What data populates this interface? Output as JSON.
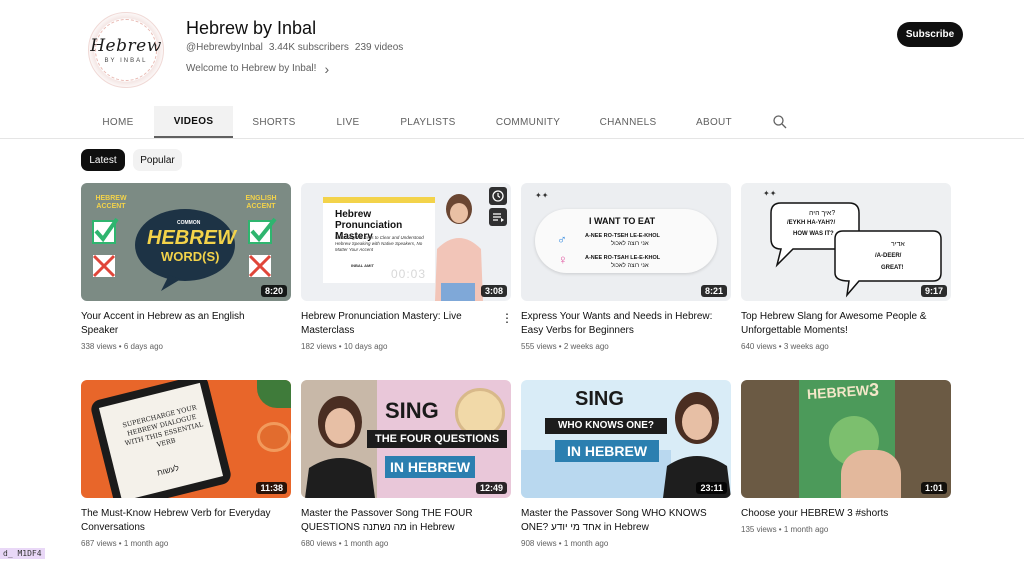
{
  "channel": {
    "logo_text": "Hebrew",
    "logo_sub": "BY INBAL",
    "name": "Hebrew by Inbal",
    "handle": "@HebrewbyInbal",
    "subscribers": "3.44K subscribers",
    "videos_count": "239 videos",
    "description": "Welcome to Hebrew by Inbal!",
    "subscribe_label": "Subscribe"
  },
  "tabs": [
    {
      "label": "HOME"
    },
    {
      "label": "VIDEOS"
    },
    {
      "label": "SHORTS"
    },
    {
      "label": "LIVE"
    },
    {
      "label": "PLAYLISTS"
    },
    {
      "label": "COMMUNITY"
    },
    {
      "label": "CHANNELS"
    },
    {
      "label": "ABOUT"
    }
  ],
  "active_tab": "VIDEOS",
  "filters": [
    {
      "label": "Latest"
    },
    {
      "label": "Popular"
    }
  ],
  "videos": [
    {
      "title": "Your Accent in Hebrew as an English Speaker",
      "meta": "338 views • 6 days ago",
      "duration": "8:20",
      "thumb": {
        "left_label": "HEBREW ACCENT",
        "right_label": "ENGLISH ACCENT",
        "center": "HEBREW",
        "center_small": "COMMON",
        "center_sub": "WORD(S)"
      }
    },
    {
      "title": "Hebrew Pronunciation Mastery: Live Masterclass",
      "meta": "182 views • 10 days ago",
      "duration": "3:08",
      "thumb": {
        "heading": "Hebrew Pronunciation Mastery",
        "sub": "Unlocking the Keys to Clear and Understood Hebrew Speaking with Native Speakers, No Matter Your Accent",
        "author": "INBAL AMIT",
        "timer": "00:03"
      }
    },
    {
      "title": "Express Your Wants and Needs in Hebrew: Easy Verbs for Beginners",
      "meta": "555 views • 2 weeks ago",
      "duration": "8:21",
      "thumb": {
        "heading": "I WANT TO EAT",
        "line1": "A-NEE  RO-TSEH  LE-E-KHOL",
        "line1_he": "אני רוצה לאכול",
        "line2": "A-NEE  RO-TSAH  LE-E-KHOL",
        "line2_he": "אני רוצה לאכול"
      }
    },
    {
      "title": "Top Hebrew Slang for Awesome People & Unforgettable Moments!",
      "meta": "640 views • 3 weeks ago",
      "duration": "9:17",
      "thumb": {
        "bubble1_he": "איך היה?",
        "bubble1": "/EYKH HA-YAH?/",
        "bubble1_en": "HOW WAS IT?",
        "bubble2_he": "אדיר",
        "bubble2": "/A-DEER/",
        "bubble2_en": "GREAT!"
      }
    },
    {
      "title": "The Must-Know Hebrew Verb for Everyday Conversations",
      "meta": "687 views • 1 month ago",
      "duration": "11:38",
      "thumb": {
        "text": "SUPERCHARGE YOUR HEBREW DIALOGUE WITH THIS ESSENTIAL VERB",
        "he": "לעשות"
      }
    },
    {
      "title": "Master the Passover Song THE FOUR QUESTIONS מה נשתנה in Hebrew",
      "meta": "680 views • 1 month ago",
      "duration": "12:49",
      "thumb": {
        "sing": "SING",
        "band": "THE FOUR QUESTIONS",
        "lang": "IN HEBREW"
      }
    },
    {
      "title": "Master the Passover Song WHO KNOWS ONE? אחד מי יודע in Hebrew",
      "meta": "908 views • 1 month ago",
      "duration": "23:11",
      "thumb": {
        "sing": "SING",
        "band": "WHO KNOWS ONE?",
        "lang": "IN HEBREW"
      }
    },
    {
      "title": "Choose your HEBREW 3 #shorts",
      "meta": "135 views • 1 month ago",
      "duration": "1:01",
      "thumb": {
        "book": "HEBREW",
        "num": "3"
      }
    }
  ],
  "overlay_tag": "d_ M1DF4",
  "colors": {
    "accent_dark": "#0f0f0f",
    "chip_bg": "#f2f2f2",
    "meta_text": "#606060",
    "yellow": "#f3d34a",
    "green_check": "#2fb56f",
    "red_x": "#e0463a"
  },
  "icons": [
    "search-icon",
    "chevron-right-icon",
    "more-vert-icon",
    "clock-icon",
    "queue-icon"
  ]
}
